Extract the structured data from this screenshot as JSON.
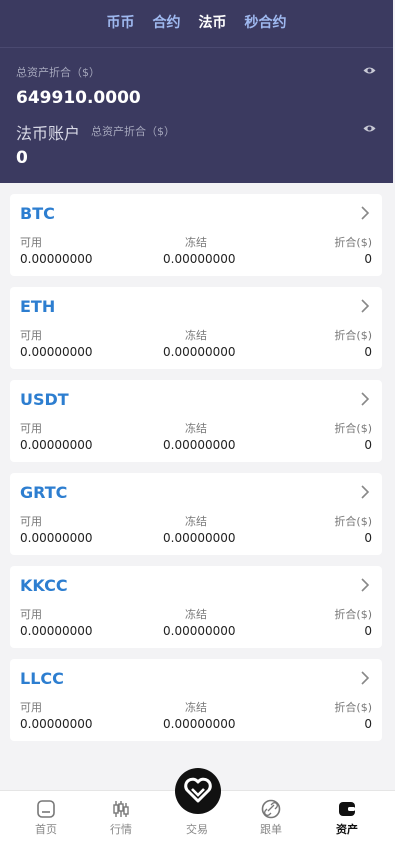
{
  "tabs": [
    "币币",
    "合约",
    "法币",
    "秒合约"
  ],
  "header": {
    "total_label": "总资产折合（$）",
    "total_value": "649910.0000",
    "fiat_label": "法币账户",
    "fiat_sub_label": "总资产折合（$）",
    "fiat_value": "0"
  },
  "assets": [
    {
      "name": "BTC",
      "available_label": "可用",
      "frozen_label": "冻结",
      "value_label": "折合($)",
      "available": "0.00000000",
      "frozen": "0.00000000",
      "value": "0"
    },
    {
      "name": "ETH",
      "available_label": "可用",
      "frozen_label": "冻结",
      "value_label": "折合($)",
      "available": "0.00000000",
      "frozen": "0.00000000",
      "value": "0"
    },
    {
      "name": "USDT",
      "available_label": "可用",
      "frozen_label": "冻结",
      "value_label": "折合($)",
      "available": "0.00000000",
      "frozen": "0.00000000",
      "value": "0"
    },
    {
      "name": "GRTC",
      "available_label": "可用",
      "frozen_label": "冻结",
      "value_label": "折合($)",
      "available": "0.00000000",
      "frozen": "0.00000000",
      "value": "0"
    },
    {
      "name": "KKCC",
      "available_label": "可用",
      "frozen_label": "冻结",
      "value_label": "折合($)",
      "available": "0.00000000",
      "frozen": "0.00000000",
      "value": "0"
    },
    {
      "name": "LLCC",
      "available_label": "可用",
      "frozen_label": "冻结",
      "value_label": "折合($)",
      "available": "0.00000000",
      "frozen": "0.00000000",
      "value": "0"
    }
  ],
  "nav": [
    {
      "label": "首页",
      "icon": "home-icon"
    },
    {
      "label": "行情",
      "icon": "candlestick-icon"
    },
    {
      "label": "交易",
      "icon": "heart-icon"
    },
    {
      "label": "跟单",
      "icon": "link-icon"
    },
    {
      "label": "资产",
      "icon": "wallet-icon"
    }
  ],
  "colors": {
    "header_bg": "#3b3a60",
    "tab_active": "#ffffff",
    "tab_inactive": "#9fb9f0",
    "asset_name": "#2d7ed0"
  }
}
